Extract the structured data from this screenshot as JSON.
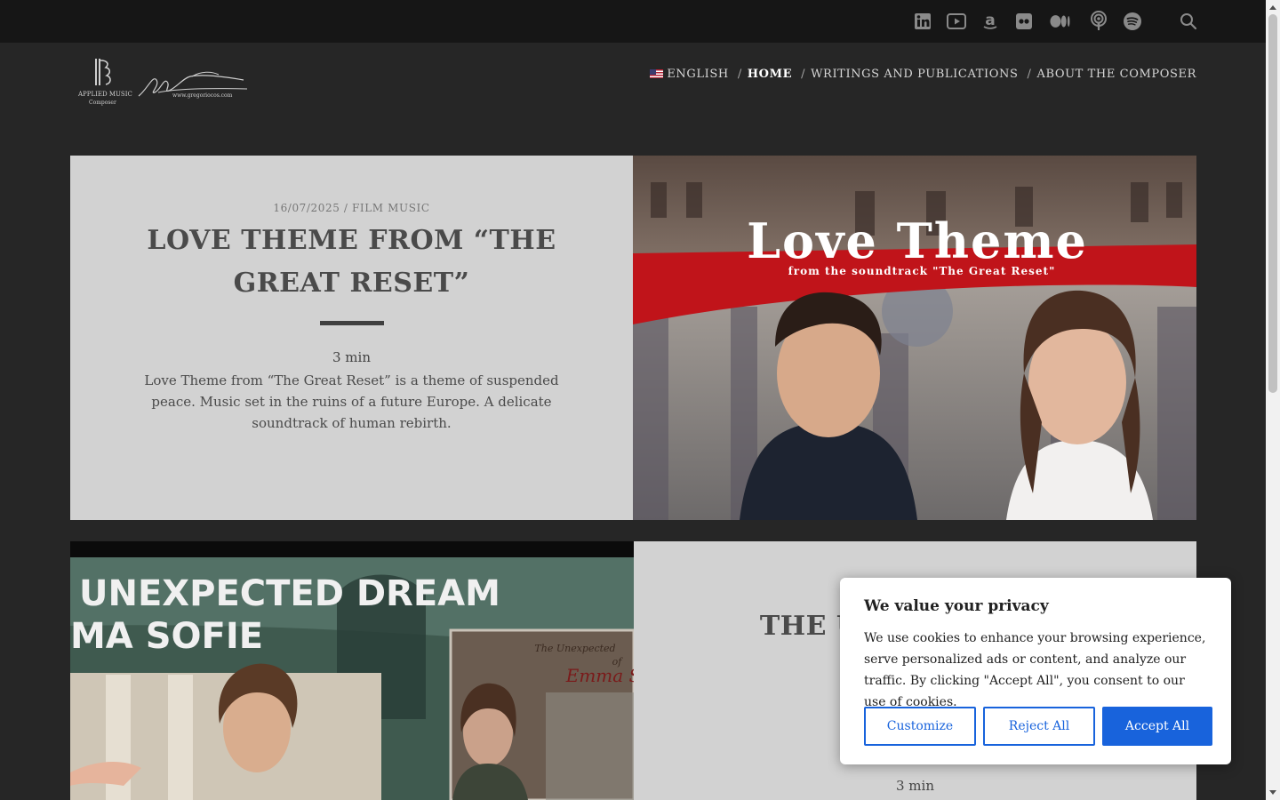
{
  "topbar": {
    "social_icons": [
      "linkedin-icon",
      "youtube-icon",
      "amazon-icon",
      "flickr-icon",
      "medium-icon",
      "podcast-icon",
      "spotify-icon",
      "search-icon"
    ]
  },
  "header": {
    "logo_text_1": "APPLIED MUSIC",
    "logo_text_2": "Composer",
    "logo_url_text": "www.gregoriocos.com",
    "nav": {
      "language": "English",
      "home": "Home",
      "writings": "Writings and Publications",
      "about": "About the composer"
    }
  },
  "posts": [
    {
      "meta": "16/07/2025 / Film Music",
      "title": "Love Theme from “The Great Reset”",
      "read_time": " 3 min",
      "excerpt": "Love Theme from “The Great Reset” is a theme of suspended peace. Music set in the ruins of a future Europe. A delicate soundtrack of human rebirth.",
      "more_icon": "",
      "image_headline": "Love Theme",
      "image_subline": "from the soundtrack \"The Great Reset\""
    },
    {
      "title": "The Une Emma So",
      "read_time": " 3 min",
      "image_headline_1": "UNEXPECTED DREAM",
      "image_headline_2": "MA SOFIE",
      "poster_line_1": "The Unexpected",
      "poster_line_2": "of",
      "poster_line_3": "Emma S"
    }
  ],
  "cookie": {
    "title": "We value your privacy",
    "text": "We use cookies to enhance your browsing experience, serve personalized ads or content, and analyze our traffic. By clicking \"Accept All\", you consent to our use of cookies.",
    "customize": "Customize",
    "reject": "Reject All",
    "accept": "Accept All"
  },
  "colors": {
    "page_bg": "#262626",
    "topbar_bg": "#161616",
    "card_bg": "#d2d2d2",
    "accent_blue": "#1863dc",
    "banner_red": "#c0141a"
  }
}
